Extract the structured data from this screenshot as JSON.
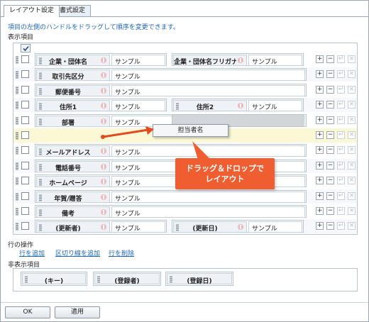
{
  "tabs": [
    {
      "label": "レイアウト設定",
      "active": true
    },
    {
      "label": "書式設定",
      "active": false
    }
  ],
  "hint": "項目の左側のハンドルをドラッグして順序を変更できます。",
  "display_section_title": "表示項目",
  "sample_value": "サンプル",
  "rows": [
    {
      "cells": [
        {
          "label": "企業・団体名",
          "value": "サンプル"
        },
        {
          "label": "企業・団体名フリガナ",
          "value": "サンプル"
        }
      ]
    },
    {
      "cells": [
        {
          "label": "取引先区分",
          "value": "サンプル"
        }
      ]
    },
    {
      "cells": [
        {
          "label": "郵便番号",
          "value": "サンプル"
        }
      ]
    },
    {
      "cells": [
        {
          "label": "住所1",
          "value": "サンプル"
        },
        {
          "label": "住所2",
          "value": "サンプル"
        }
      ]
    },
    {
      "cells": [
        {
          "label": "部署",
          "value": "サンプル"
        }
      ]
    },
    {
      "cells": []
    },
    {
      "cells": [
        {
          "label": "メールアドレス",
          "value": "サンプル"
        }
      ]
    },
    {
      "cells": [
        {
          "label": "電話番号",
          "value": "サンプル"
        }
      ]
    },
    {
      "cells": [
        {
          "label": "ホームページ",
          "value": "サンプル"
        }
      ]
    },
    {
      "cells": [
        {
          "label": "年賀/贈答",
          "value": "サンプル"
        }
      ]
    },
    {
      "cells": [
        {
          "label": "備考",
          "value": "サンプル"
        }
      ]
    },
    {
      "cells": [
        {
          "label": "(更新者)",
          "value": "サンプル"
        },
        {
          "label": "(更新日)",
          "value": "サンプル"
        }
      ]
    }
  ],
  "row_buttons": [
    "+",
    "−",
    "↵",
    "×"
  ],
  "dragged_item": "担当者名",
  "callout": {
    "line1": "ドラッグ＆ドロップで",
    "line2": "レイアウト"
  },
  "callout_color": "#ef5e30",
  "row_ops": {
    "title": "行の操作",
    "add_row": "行を追加",
    "add_separator": "区切り線を追加",
    "delete_row": "行を削除"
  },
  "hidden_section_title": "非表示項目",
  "hidden_items": [
    "(キー)",
    "(登録者)",
    "(登録日)"
  ],
  "footer": {
    "ok": "OK",
    "apply": "適用"
  },
  "link_color": "#1f66b3"
}
